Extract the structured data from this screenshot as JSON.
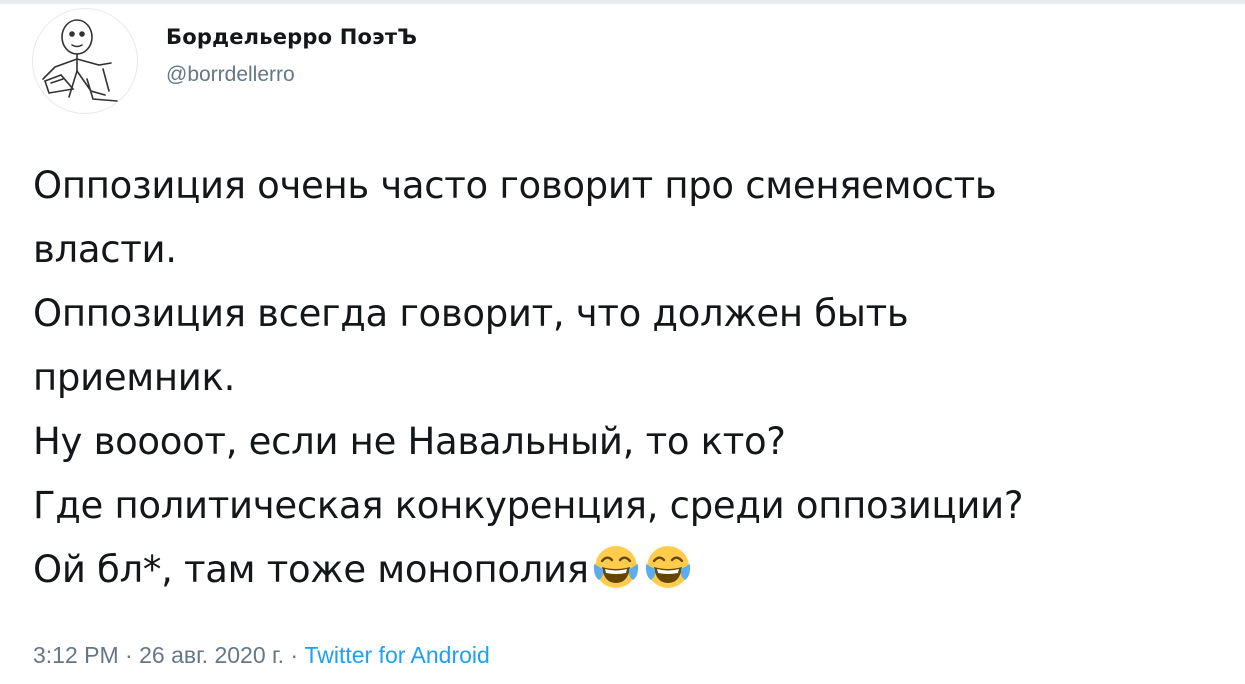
{
  "tweet": {
    "author": {
      "display_name": "Бордельерро ПоэтЪ",
      "handle": "@borrdellerro",
      "avatar_icon": "sketch-portrait-avatar"
    },
    "lines": [
      "Оппозиция очень часто говорит про сменяемость",
      "власти.",
      "Оппозиция всегда говорит, что должен быть",
      "приемник.",
      "Ну воооот, если не Навальный, то кто?",
      "Где политическая конкуренция, среди оппозиции?",
      "Ой бл*, там тоже монополия"
    ],
    "trailing_emoji": [
      "face-with-tears-of-joy-icon",
      "face-with-tears-of-joy-icon"
    ],
    "meta": {
      "time": "3:12 PM",
      "separator": "·",
      "date": "26 авг. 2020 г.",
      "source": "Twitter for Android"
    }
  },
  "colors": {
    "text": "#14171a",
    "secondary": "#657786",
    "link": "#1da1f2",
    "divider": "#e6ecf0",
    "emoji_face": "#ffcc4d",
    "emoji_tears": "#5dadec"
  }
}
